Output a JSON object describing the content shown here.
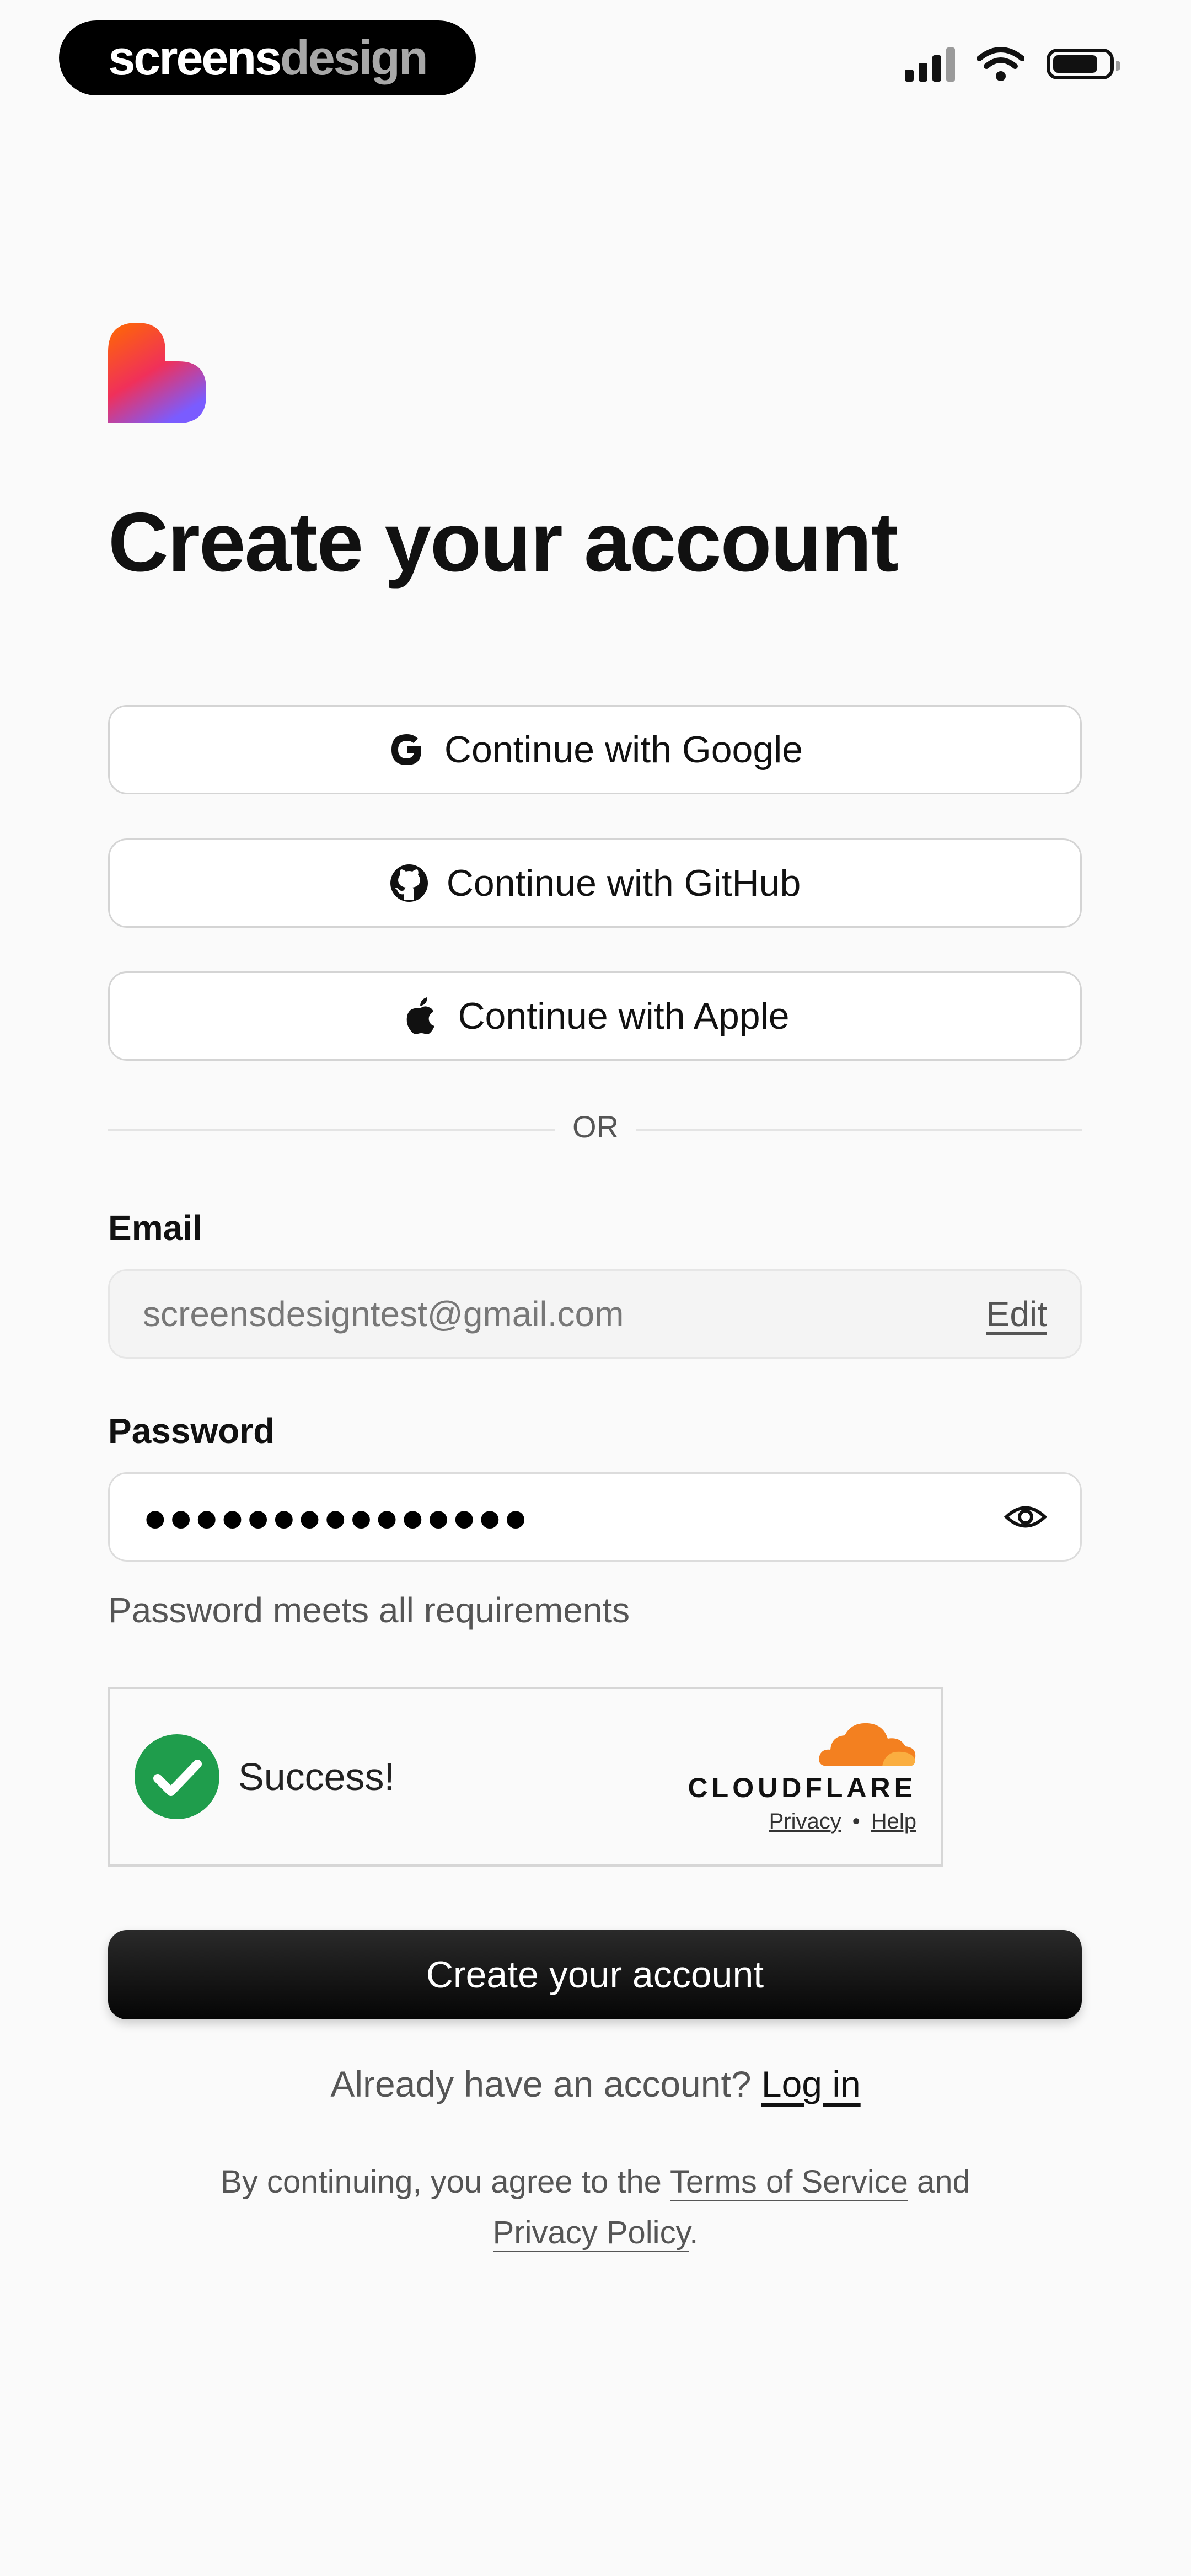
{
  "status_bar": {
    "brand_bold": "screens",
    "brand_dim": "design"
  },
  "title": "Create your account",
  "social": {
    "google": "Continue with Google",
    "github": "Continue with GitHub",
    "apple": "Continue with Apple"
  },
  "divider": "OR",
  "email": {
    "label": "Email",
    "value": "screensdesigntest@gmail.com",
    "edit": "Edit"
  },
  "password": {
    "label": "Password",
    "value": "●●●●●●●●●●●●●●●",
    "hint": "Password meets all requirements"
  },
  "captcha": {
    "status": "Success!",
    "brand": "CLOUDFLARE",
    "privacy": "Privacy",
    "separator": "•",
    "help": "Help"
  },
  "submit": "Create your account",
  "login": {
    "prompt": "Already have an account?",
    "link": "Log in"
  },
  "legal": {
    "prefix": "By continuing, you agree to the",
    "terms": "Terms of Service",
    "and": "and",
    "privacy": "Privacy Policy",
    "suffix": "."
  },
  "colors": {
    "logo_top": "#ff6a00",
    "logo_bottom": "#7a5cff",
    "success_green": "#1f9d4c",
    "cloudflare_orange": "#f38020"
  }
}
